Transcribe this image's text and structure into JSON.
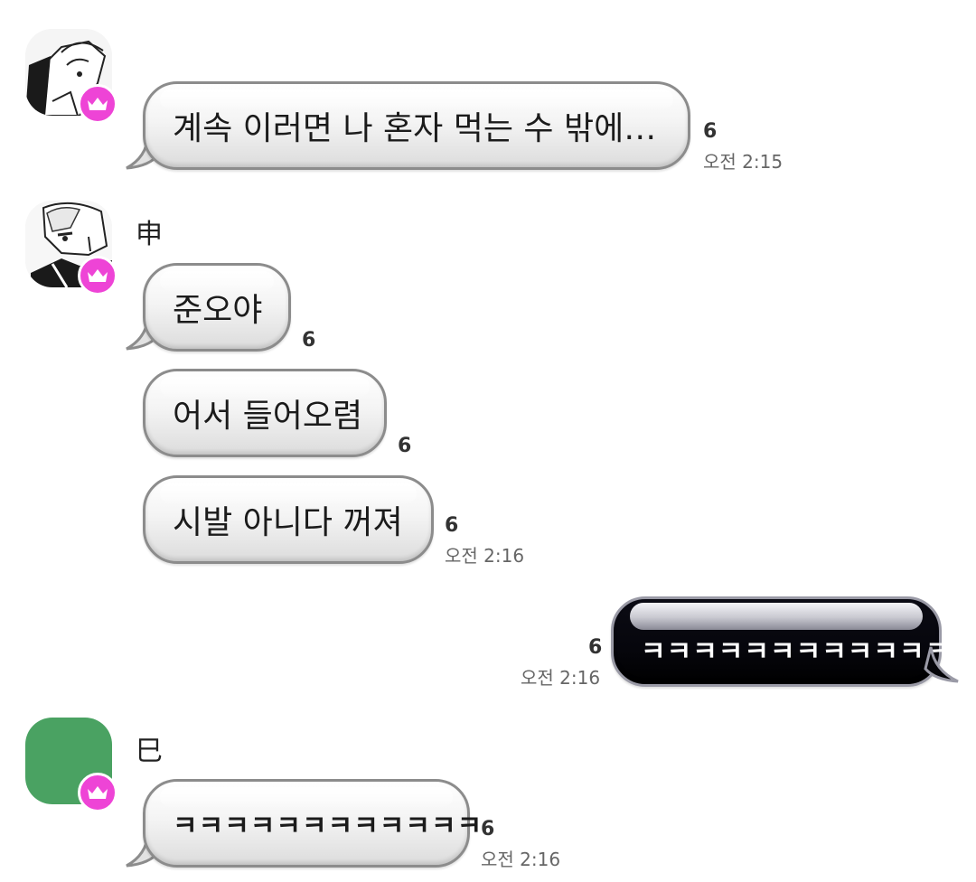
{
  "messages": [
    {
      "sender": "",
      "text": "계속 이러면 나 혼자 먹는 수 밖에…",
      "read": "6",
      "time": "오전 2:15"
    },
    {
      "sender": "申",
      "text": "준오야",
      "read": "6",
      "time": ""
    },
    {
      "sender": "申",
      "text": "어서 들어오렴",
      "read": "6",
      "time": ""
    },
    {
      "sender": "申",
      "text": "시발 아니다 꺼져",
      "read": "6",
      "time": "오전 2:16"
    },
    {
      "sender": "me",
      "text": "ㅋㅋㅋㅋㅋㅋㅋㅋㅋㅋㅋㅋ",
      "read": "6",
      "time": "오전 2:16"
    },
    {
      "sender": "巳",
      "text": "ㅋㅋㅋㅋㅋㅋㅋㅋㅋㅋㅋㅋ",
      "read": "6",
      "time": "오전 2:16"
    }
  ],
  "senders": {
    "shin": "申",
    "sa": "巳"
  },
  "icons": {
    "badge": "crown-icon",
    "badge_color": "#ee44d6",
    "avatar3_color": "#4aa262"
  }
}
